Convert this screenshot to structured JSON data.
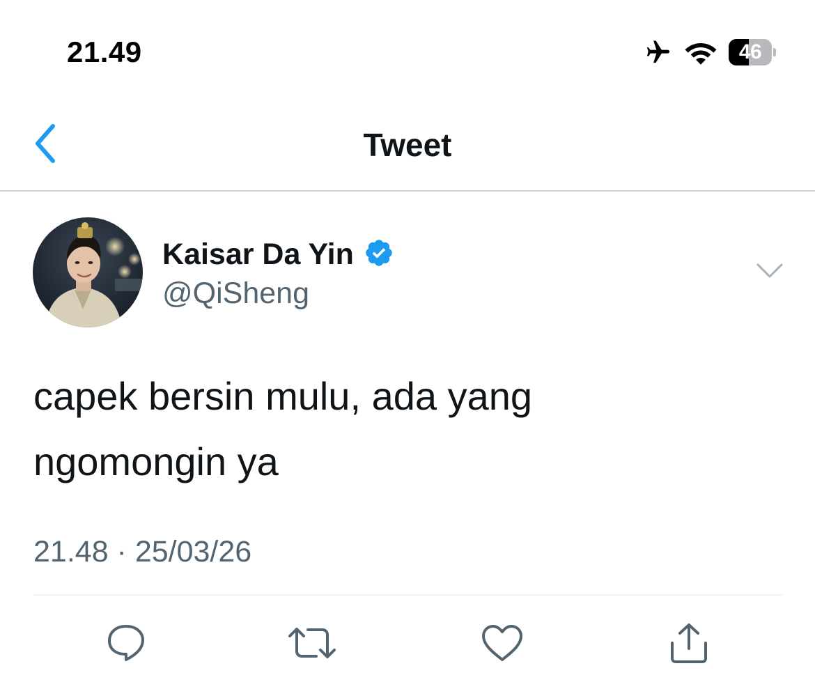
{
  "status_bar": {
    "time": "21.49",
    "battery_level": "46",
    "battery_fraction": 0.46,
    "icons": [
      "airplane-icon",
      "wifi-icon",
      "battery-icon"
    ]
  },
  "nav": {
    "title": "Tweet",
    "back_icon": "chevron-left-icon"
  },
  "tweet": {
    "author": {
      "display_name": "Kaisar Da Yin",
      "handle": "@QiSheng",
      "verified": true
    },
    "text": "capek bersin mulu, ada yang\nngomongin ya",
    "timestamp": "21.48 · 25/03/26",
    "menu_icon": "chevron-down-icon"
  },
  "actions": [
    {
      "name": "reply",
      "icon": "reply-icon"
    },
    {
      "name": "retweet",
      "icon": "retweet-icon"
    },
    {
      "name": "like",
      "icon": "heart-icon"
    },
    {
      "name": "share",
      "icon": "share-icon"
    }
  ],
  "colors": {
    "accent": "#1d9bf0",
    "text_primary": "#0f1419",
    "text_secondary": "#536471",
    "divider": "#cfd3d6",
    "icon": "#536471"
  }
}
